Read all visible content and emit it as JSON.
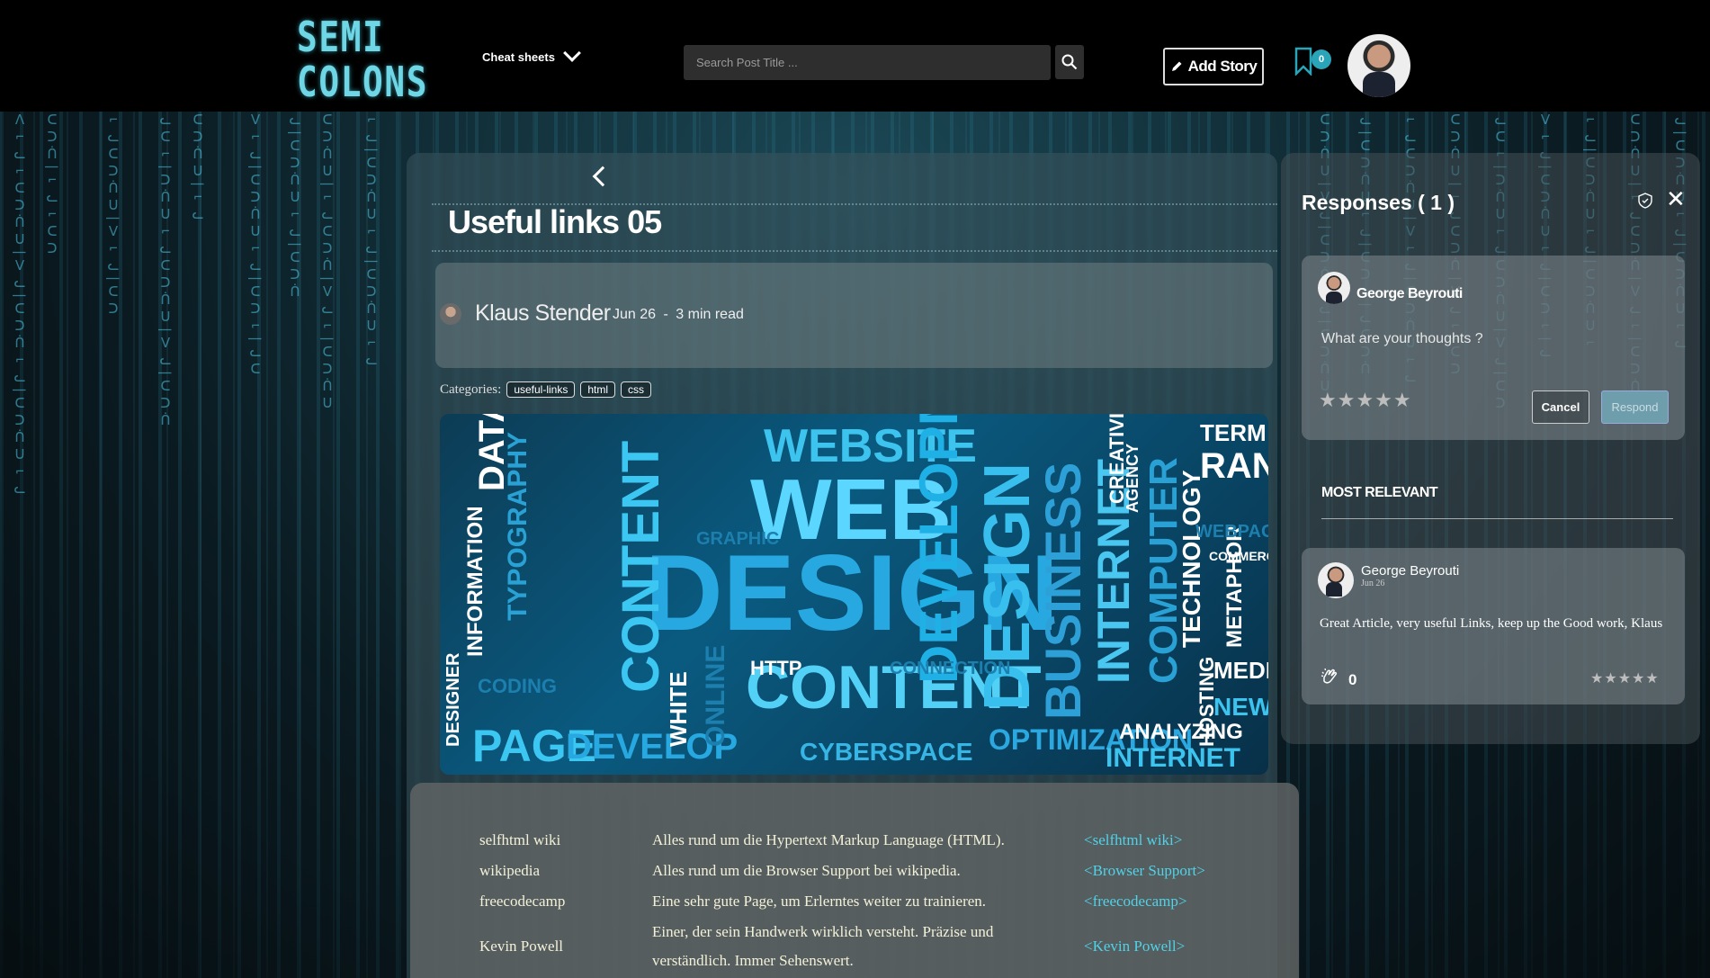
{
  "header": {
    "logo_line1": "SEMI",
    "logo_line2": "COLONS",
    "cheat_sheets_label": "Cheat sheets",
    "search_placeholder": "Search Post Title ...",
    "add_story_label": "Add Story",
    "bookmark_count": "0"
  },
  "article": {
    "title": "Useful links 05",
    "author": "Klaus Stender",
    "date": "Jun 26",
    "separator": "-",
    "read_time": "3 min read",
    "categories_label": "Categories:",
    "tags": [
      "useful-links",
      "html",
      "css"
    ],
    "links": [
      {
        "name": "selfhtml wiki",
        "description": "Alles rund um die Hypertext Markup Language (HTML).",
        "link": "<selfhtml wiki>"
      },
      {
        "name": "wikipedia",
        "description": "Alles rund um die Browser Support bei wikipedia.",
        "link": "<Browser Support>"
      },
      {
        "name": "freecodecamp",
        "description": "Eine sehr gute Page, um Erlerntes weiter zu trainieren.",
        "link": "<freecodecamp>"
      },
      {
        "name": "Kevin Powell",
        "description_line1": "Einer, der sein Handwerk wirklich versteht. Präzise und",
        "description_line2": "verständlich. Immer Sehenswert.",
        "link": "<Kevin Powell>"
      }
    ],
    "hero_words": [
      "WEBSITE",
      "WEB",
      "DESIGN",
      "CONTENT",
      "DEVELOPMENT",
      "DESIGN",
      "BUSINESS",
      "INTERNET",
      "COMPUTER",
      "PAGE",
      "DEVELOP",
      "CYBERSPACE",
      "OPTIMIZATION",
      "ANALYZING",
      "INTERNET",
      "TECHNOLOGY",
      "RANK",
      "TERM",
      "MEDIA",
      "NEWS",
      "CODING",
      "GRAPHIC",
      "HTTP",
      "CONNECTION",
      "CREATIVITY",
      "WHITE",
      "ONLINE",
      "INFORMATION",
      "DESIGNER",
      "TYPOGRAPHY",
      "DATA",
      "CONTENT",
      "HOSTING",
      "METAPHOR",
      "COMMERCE",
      "AGENCY",
      "WEBPAGE"
    ]
  },
  "responses": {
    "title": "Responses ( 1 )",
    "current_user": "George Beyrouti",
    "placeholder": "What are your thoughts ?",
    "cancel_label": "Cancel",
    "respond_label": "Respond",
    "most_relevant_label": "MOST RELEVANT",
    "comments": [
      {
        "author": "George Beyrouti",
        "date": "Jun 26",
        "text": "Great Article, very useful Links, keep up the Good work, Klaus",
        "claps": "0"
      }
    ]
  },
  "colors": {
    "accent": "#4fd3e9",
    "badge": "#2aa4b8",
    "respond_button": "#6e9eab"
  }
}
